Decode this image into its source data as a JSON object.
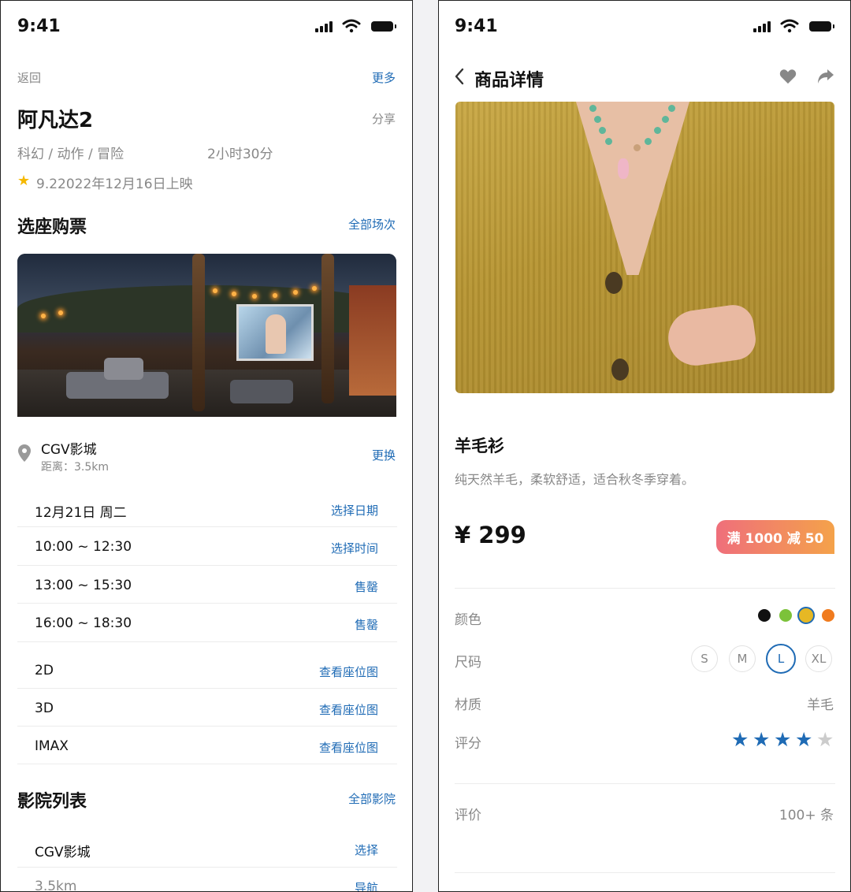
{
  "left": {
    "status_time": "9:41",
    "nav": {
      "back": "返回",
      "more": "更多"
    },
    "movie": {
      "title": "阿凡达2",
      "share": "分享",
      "genres": "科幻 / 动作 / 冒险",
      "duration": "2小时30分",
      "rating_release": "9.22022年12月16日上映"
    },
    "tickets": {
      "heading": "选座购票",
      "all_sessions": "全部场次"
    },
    "cinema": {
      "name": "CGV影城",
      "distance": "距离：3.5km",
      "change": "更换"
    },
    "schedule": [
      {
        "label": "12月21日 周二",
        "action": "选择日期"
      },
      {
        "label": "10:00 ~ 12:30",
        "action": "选择时间"
      },
      {
        "label": "13:00 ~ 15:30",
        "action": "售罄"
      },
      {
        "label": "16:00 ~ 18:30",
        "action": "售罄"
      }
    ],
    "formats": [
      {
        "label": "2D",
        "action": "查看座位图"
      },
      {
        "label": "3D",
        "action": "查看座位图"
      },
      {
        "label": "IMAX",
        "action": "查看座位图"
      }
    ],
    "cinema_list": {
      "heading": "影院列表",
      "all": "全部影院",
      "items": [
        {
          "label": "CGV影城",
          "action": "选择"
        },
        {
          "label": "3.5km",
          "action": "导航"
        }
      ]
    }
  },
  "right": {
    "status_time": "9:41",
    "header": {
      "title": "商品详情"
    },
    "product": {
      "name": "羊毛衫",
      "desc": "纯天然羊毛，柔软舒适，适合秋冬季穿着。",
      "price": "¥ 299",
      "promo": "满 1000 减 50"
    },
    "attrs": {
      "color_label": "颜色",
      "colors": [
        "#111111",
        "#7cc23a",
        "#e6b824",
        "#f07b1e"
      ],
      "selected_color": "#e6b824",
      "size_label": "尺码",
      "sizes": [
        "S",
        "M",
        "L",
        "XL"
      ],
      "selected_size": "L",
      "material_label": "材质",
      "material": "羊毛",
      "rating_label": "评分",
      "rating": 4,
      "rating_max": 5,
      "review_label": "评价",
      "review_count": "100+ 条"
    },
    "colors": {
      "accent": "#1f6bb5",
      "star_on": "#1f6bb5",
      "star_off": "#cccccc"
    }
  }
}
